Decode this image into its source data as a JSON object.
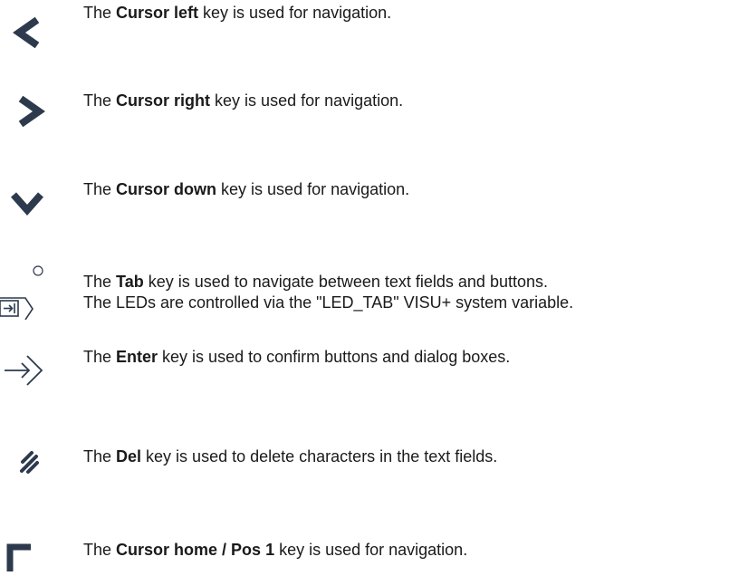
{
  "colors": {
    "icon": "#2d3a4e",
    "text": "#1a1a1a"
  },
  "keys": [
    {
      "icon": "chevron-left-icon",
      "pre": "The ",
      "name": "Cursor left",
      "post": " key is used for navigation."
    },
    {
      "icon": "chevron-right-icon",
      "pre": "The ",
      "name": "Cursor right",
      "post": " key is used for navigation."
    },
    {
      "icon": "chevron-down-icon",
      "pre": "The ",
      "name": "Cursor down",
      "post": " key is used for navigation."
    },
    {
      "icon": "tab-key-icon",
      "pre": "The ",
      "name": "Tab",
      "post": " key is used to navigate between text fields and buttons.",
      "line2": "The LEDs are controlled via the \"LED_TAB\" VISU+ system variable."
    },
    {
      "icon": "enter-key-icon",
      "pre": "The ",
      "name": "Enter",
      "post": " key is used to confirm buttons and dialog boxes."
    },
    {
      "icon": "delete-key-icon",
      "pre": "The ",
      "name": "Del",
      "post": " key is used to delete characters in the text fields."
    },
    {
      "icon": "home-key-icon",
      "pre": "The ",
      "name": "Cursor home / Pos 1",
      "post": " key is used for navigation."
    }
  ]
}
